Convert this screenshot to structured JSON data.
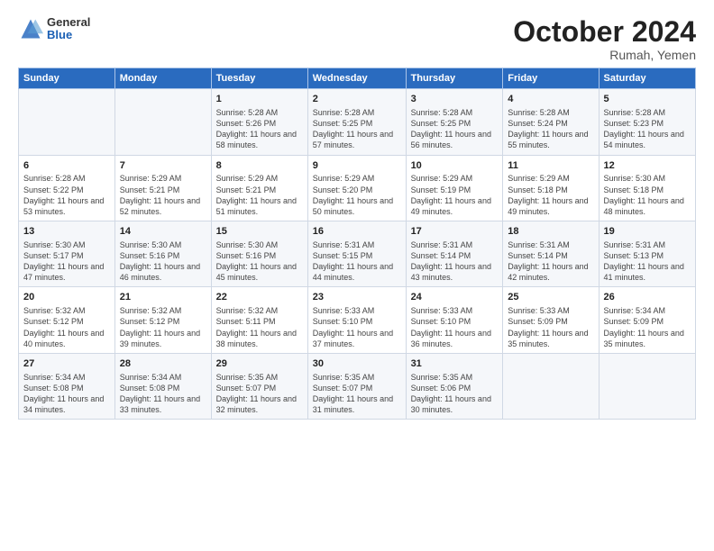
{
  "logo": {
    "general": "General",
    "blue": "Blue"
  },
  "header": {
    "month": "October 2024",
    "location": "Rumah, Yemen"
  },
  "weekdays": [
    "Sunday",
    "Monday",
    "Tuesday",
    "Wednesday",
    "Thursday",
    "Friday",
    "Saturday"
  ],
  "weeks": [
    [
      {
        "day": "",
        "info": ""
      },
      {
        "day": "",
        "info": ""
      },
      {
        "day": "1",
        "info": "Sunrise: 5:28 AM\nSunset: 5:26 PM\nDaylight: 11 hours and 58 minutes."
      },
      {
        "day": "2",
        "info": "Sunrise: 5:28 AM\nSunset: 5:25 PM\nDaylight: 11 hours and 57 minutes."
      },
      {
        "day": "3",
        "info": "Sunrise: 5:28 AM\nSunset: 5:25 PM\nDaylight: 11 hours and 56 minutes."
      },
      {
        "day": "4",
        "info": "Sunrise: 5:28 AM\nSunset: 5:24 PM\nDaylight: 11 hours and 55 minutes."
      },
      {
        "day": "5",
        "info": "Sunrise: 5:28 AM\nSunset: 5:23 PM\nDaylight: 11 hours and 54 minutes."
      }
    ],
    [
      {
        "day": "6",
        "info": "Sunrise: 5:28 AM\nSunset: 5:22 PM\nDaylight: 11 hours and 53 minutes."
      },
      {
        "day": "7",
        "info": "Sunrise: 5:29 AM\nSunset: 5:21 PM\nDaylight: 11 hours and 52 minutes."
      },
      {
        "day": "8",
        "info": "Sunrise: 5:29 AM\nSunset: 5:21 PM\nDaylight: 11 hours and 51 minutes."
      },
      {
        "day": "9",
        "info": "Sunrise: 5:29 AM\nSunset: 5:20 PM\nDaylight: 11 hours and 50 minutes."
      },
      {
        "day": "10",
        "info": "Sunrise: 5:29 AM\nSunset: 5:19 PM\nDaylight: 11 hours and 49 minutes."
      },
      {
        "day": "11",
        "info": "Sunrise: 5:29 AM\nSunset: 5:18 PM\nDaylight: 11 hours and 49 minutes."
      },
      {
        "day": "12",
        "info": "Sunrise: 5:30 AM\nSunset: 5:18 PM\nDaylight: 11 hours and 48 minutes."
      }
    ],
    [
      {
        "day": "13",
        "info": "Sunrise: 5:30 AM\nSunset: 5:17 PM\nDaylight: 11 hours and 47 minutes."
      },
      {
        "day": "14",
        "info": "Sunrise: 5:30 AM\nSunset: 5:16 PM\nDaylight: 11 hours and 46 minutes."
      },
      {
        "day": "15",
        "info": "Sunrise: 5:30 AM\nSunset: 5:16 PM\nDaylight: 11 hours and 45 minutes."
      },
      {
        "day": "16",
        "info": "Sunrise: 5:31 AM\nSunset: 5:15 PM\nDaylight: 11 hours and 44 minutes."
      },
      {
        "day": "17",
        "info": "Sunrise: 5:31 AM\nSunset: 5:14 PM\nDaylight: 11 hours and 43 minutes."
      },
      {
        "day": "18",
        "info": "Sunrise: 5:31 AM\nSunset: 5:14 PM\nDaylight: 11 hours and 42 minutes."
      },
      {
        "day": "19",
        "info": "Sunrise: 5:31 AM\nSunset: 5:13 PM\nDaylight: 11 hours and 41 minutes."
      }
    ],
    [
      {
        "day": "20",
        "info": "Sunrise: 5:32 AM\nSunset: 5:12 PM\nDaylight: 11 hours and 40 minutes."
      },
      {
        "day": "21",
        "info": "Sunrise: 5:32 AM\nSunset: 5:12 PM\nDaylight: 11 hours and 39 minutes."
      },
      {
        "day": "22",
        "info": "Sunrise: 5:32 AM\nSunset: 5:11 PM\nDaylight: 11 hours and 38 minutes."
      },
      {
        "day": "23",
        "info": "Sunrise: 5:33 AM\nSunset: 5:10 PM\nDaylight: 11 hours and 37 minutes."
      },
      {
        "day": "24",
        "info": "Sunrise: 5:33 AM\nSunset: 5:10 PM\nDaylight: 11 hours and 36 minutes."
      },
      {
        "day": "25",
        "info": "Sunrise: 5:33 AM\nSunset: 5:09 PM\nDaylight: 11 hours and 35 minutes."
      },
      {
        "day": "26",
        "info": "Sunrise: 5:34 AM\nSunset: 5:09 PM\nDaylight: 11 hours and 35 minutes."
      }
    ],
    [
      {
        "day": "27",
        "info": "Sunrise: 5:34 AM\nSunset: 5:08 PM\nDaylight: 11 hours and 34 minutes."
      },
      {
        "day": "28",
        "info": "Sunrise: 5:34 AM\nSunset: 5:08 PM\nDaylight: 11 hours and 33 minutes."
      },
      {
        "day": "29",
        "info": "Sunrise: 5:35 AM\nSunset: 5:07 PM\nDaylight: 11 hours and 32 minutes."
      },
      {
        "day": "30",
        "info": "Sunrise: 5:35 AM\nSunset: 5:07 PM\nDaylight: 11 hours and 31 minutes."
      },
      {
        "day": "31",
        "info": "Sunrise: 5:35 AM\nSunset: 5:06 PM\nDaylight: 11 hours and 30 minutes."
      },
      {
        "day": "",
        "info": ""
      },
      {
        "day": "",
        "info": ""
      }
    ]
  ]
}
